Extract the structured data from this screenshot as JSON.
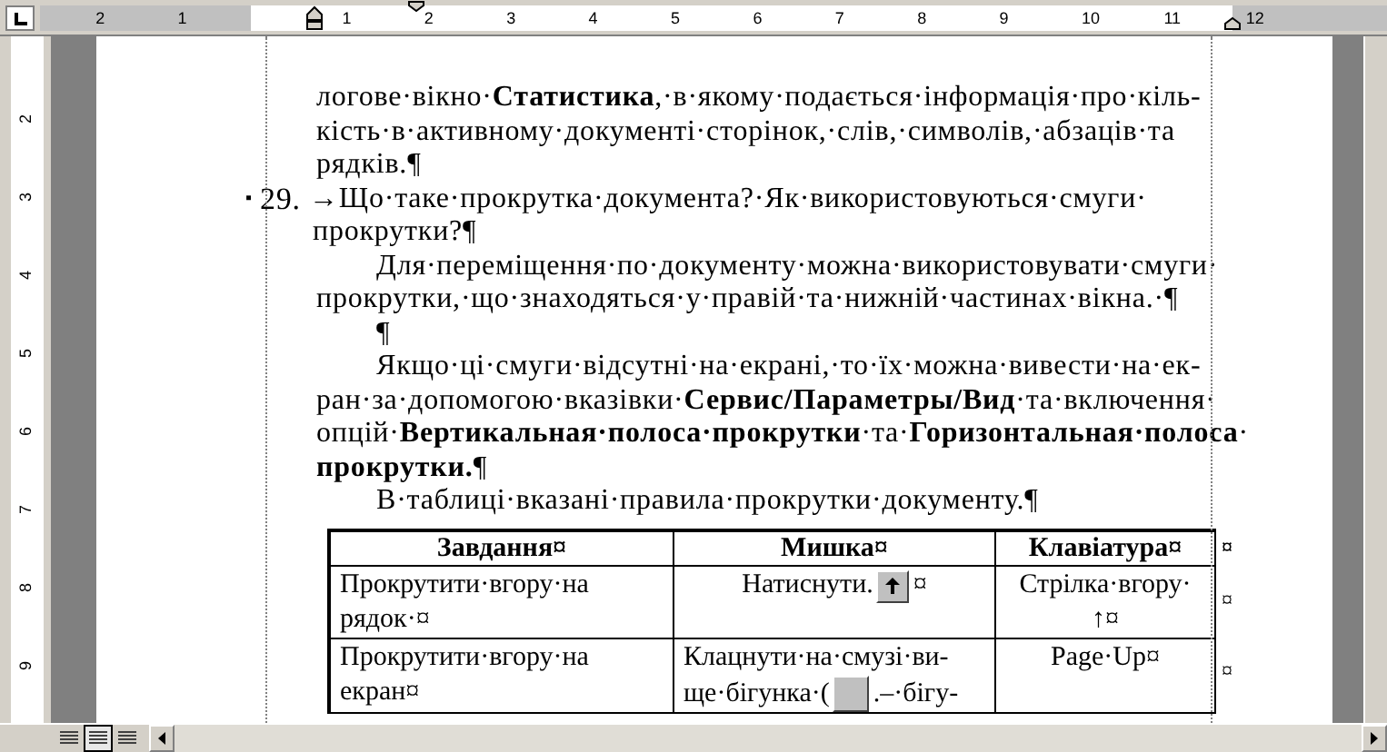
{
  "ruler": {
    "labels": [
      "2",
      "1",
      "1",
      "2",
      "3",
      "4",
      "5",
      "6",
      "7",
      "8",
      "9",
      "10",
      "11",
      "12"
    ]
  },
  "vertical_ruler": {
    "labels": [
      "2",
      "3",
      "4",
      "5",
      "6",
      "7",
      "8",
      "9"
    ]
  },
  "document": {
    "blocks": [
      {
        "kind": "text",
        "indent": false,
        "lines": [
          "логове·вікно·**Статистика**,·в·якому·подається·інформація·про·кіль-",
          "кість·в·активному·документі·сторінок,·слів,·символів,·абзаців·та",
          "рядків.¶"
        ]
      },
      {
        "kind": "numbered",
        "bullet": "▪",
        "number": "29.",
        "lines": [
          "→Що·таке·прокрутка·документа?·Як·використовуються·смуги·",
          "прокрутки?¶"
        ]
      },
      {
        "kind": "text",
        "indent": true,
        "lines": [
          "Для·переміщення·по·документу·можна·використовувати·смуги·",
          "прокрутки,·що·знаходяться·у·правій·та·нижній·частинах·вікна.·¶"
        ]
      },
      {
        "kind": "text",
        "indent": true,
        "lines": [
          "¶"
        ]
      },
      {
        "kind": "text",
        "indent": true,
        "lines": [
          "Якщо·ці·смуги·відсутні·на·екрані,·то·їх·можна·вивести·на·ек-",
          "ран·за·допомогою·вказівки·**Сервис/Параметры/Вид**·та·включення·",
          "опцій·**Вертикальная·полоса·прокрутки**·та·**Горизонтальная·полоса**·",
          "**прокрутки.**¶"
        ]
      },
      {
        "kind": "text",
        "indent": true,
        "lines": [
          "В·таблиці·вказані·правила·прокрутки·документу.¶"
        ]
      }
    ],
    "table": {
      "header": [
        "Завдання¤",
        "Мишка¤",
        "Клавіатура¤"
      ],
      "header_end": "¤",
      "rows": [
        {
          "cells": [
            {
              "kind": "text",
              "lines": [
                "Прокрутити·вгору·на",
                "рядок·¤"
              ]
            },
            {
              "kind": "up_button",
              "before": "Натиснути.",
              "after": "¤"
            },
            {
              "kind": "text",
              "lines": [
                "Стрілка·вгору·",
                "↑¤"
              ]
            }
          ],
          "end": "¤"
        },
        {
          "cells": [
            {
              "kind": "text",
              "lines": [
                "Прокрутити·вгору·на",
                "екран¤"
              ]
            },
            {
              "kind": "scroll_thumb",
              "lines": [
                "Клацнути·на·смузі·ви-"
              ],
              "before": "ще·бігунка·(",
              "after": ".–·бігу-"
            },
            {
              "kind": "text",
              "lines": [
                "Page·Up¤"
              ]
            }
          ],
          "end": "¤"
        }
      ]
    }
  },
  "view_buttons": [
    {
      "selected": false
    },
    {
      "selected": true
    },
    {
      "selected": false
    }
  ]
}
